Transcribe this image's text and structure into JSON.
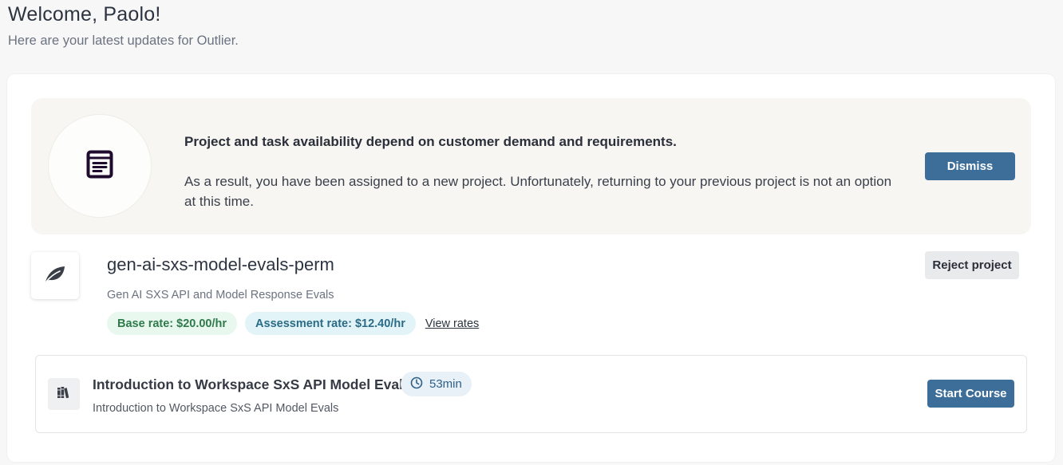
{
  "header": {
    "title": "Welcome, Paolo!",
    "subtitle": "Here are your latest updates for Outlier."
  },
  "notice": {
    "icon": "document-icon",
    "heading": "Project and task availability depend on customer demand and requirements.",
    "body": "As a result, you have been assigned to a new project. Unfortunately, returning to your previous project is not an option at this time.",
    "dismiss_label": "Dismiss"
  },
  "project": {
    "icon": "leaf-icon",
    "name": "gen-ai-sxs-model-evals-perm",
    "description": "Gen AI SXS API and Model Response Evals",
    "base_rate": "Base rate: $20.00/hr",
    "assessment_rate": "Assessment rate: $12.40/hr",
    "view_rates_label": "View rates",
    "reject_label": "Reject project"
  },
  "course": {
    "icon": "books-icon",
    "title": "Introduction to Workspace SxS API Model Evals",
    "duration": "53min",
    "subtitle": "Introduction to Workspace SxS API Model Evals",
    "start_label": "Start Course"
  },
  "colors": {
    "primary_button": "#3d6e9a",
    "base_rate_bg": "#e9f8ef",
    "base_rate_text": "#2f7a4b",
    "assessment_rate_bg": "#e3f4f8",
    "assessment_rate_text": "#2a6b86",
    "notice_bg": "#f7f6f3"
  }
}
